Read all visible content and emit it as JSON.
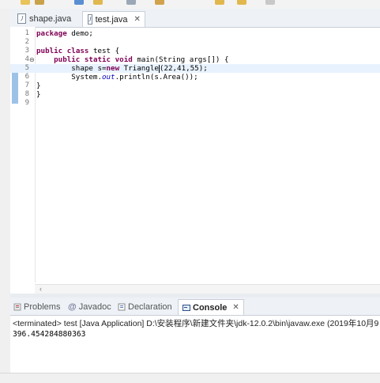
{
  "editor": {
    "tabs": [
      {
        "label": "shape.java",
        "icon": "java-file-icon",
        "active": false
      },
      {
        "label": "test.java",
        "icon": "java-file-icon",
        "active": true
      }
    ],
    "lines": [
      {
        "n": "1",
        "text": "package demo;"
      },
      {
        "n": "2",
        "text": ""
      },
      {
        "n": "3",
        "text": "public class test {"
      },
      {
        "n": "4",
        "text": "    public static void main(String args[]) {"
      },
      {
        "n": "5",
        "text": "        shape s=new Triangle(22,41,55);"
      },
      {
        "n": "6",
        "text": "        System.out.println(s.Area());"
      },
      {
        "n": "7",
        "text": "}"
      },
      {
        "n": "8",
        "text": "}"
      },
      {
        "n": "9",
        "text": ""
      }
    ]
  },
  "console": {
    "tabs": [
      {
        "label": "Problems",
        "icon": "problems-icon"
      },
      {
        "label": "Javadoc",
        "icon": "javadoc-icon"
      },
      {
        "label": "Declaration",
        "icon": "declaration-icon"
      },
      {
        "label": "Console",
        "icon": "console-icon",
        "active": true
      }
    ],
    "terminated": "<terminated> test [Java Application] D:\\安装程序\\新建文件夹\\jdk-12.0.2\\bin\\javaw.exe (2019年10月9",
    "output": "396.454284880363"
  },
  "colors": {
    "keyword": "#7f0055",
    "field": "#0000c0",
    "highlight": "#e8f2fe"
  }
}
